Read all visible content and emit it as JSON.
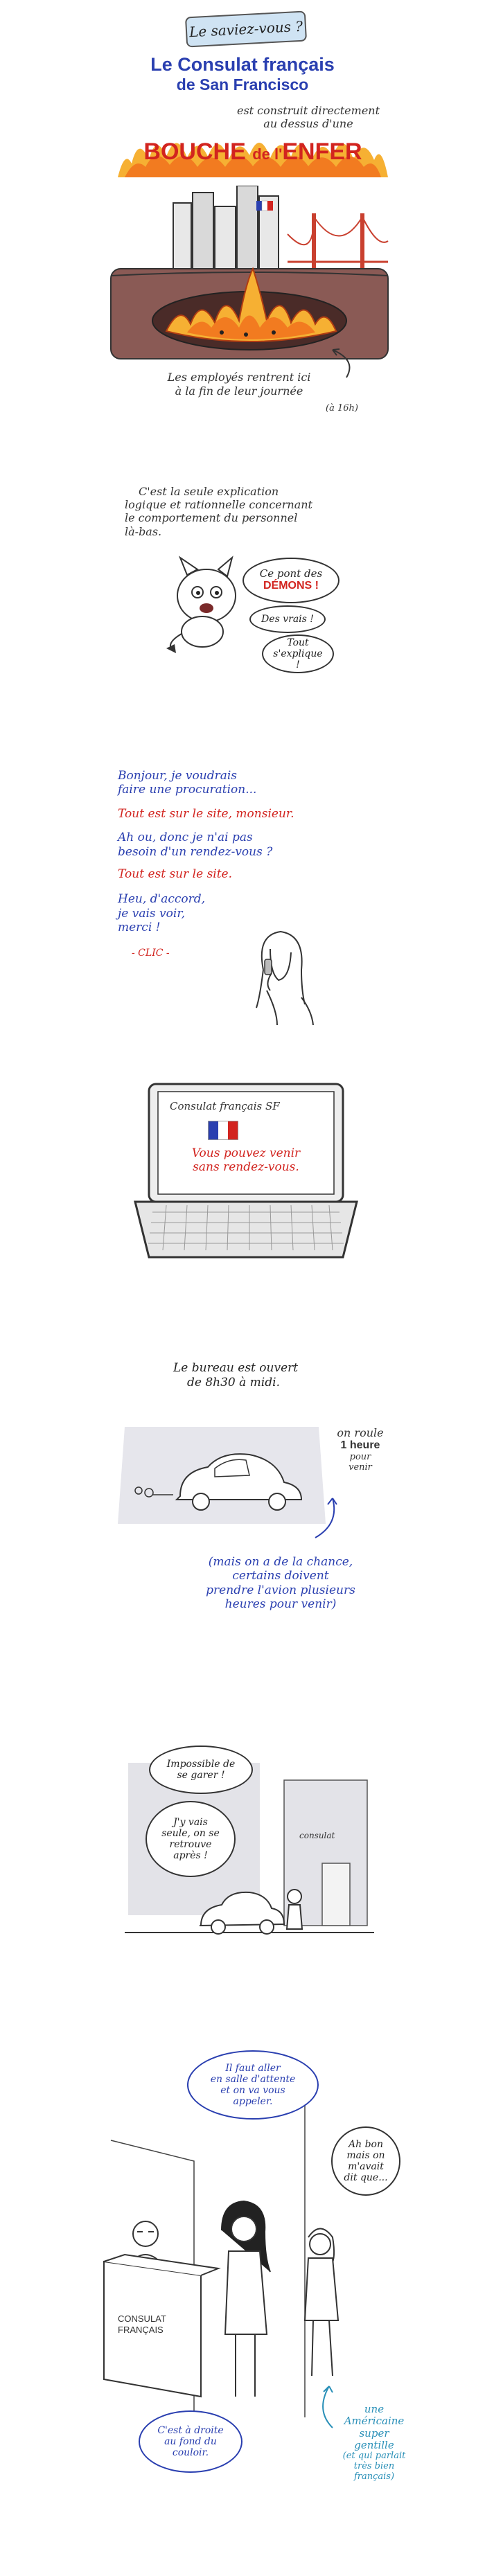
{
  "panel1": {
    "badge": "Le saviez-vous ?",
    "title_line1": "Le Consulat français",
    "title_line2": "de San Francisco",
    "subtitle_line1": "est construit directement",
    "subtitle_line2": "au dessus d'une",
    "headline_a": "BOUCHE",
    "headline_b": "de l'",
    "headline_c": "ENFER",
    "caption_line1": "Les employés rentrent ici",
    "caption_line2": "à la fin de leur journée",
    "caption_note": "(à 16h)"
  },
  "panel2": {
    "text_line1": "C'est la seule explication",
    "text_line2": "logique et rationnelle concernant",
    "text_line3": "le comportement du personnel",
    "text_line4": "là-bas.",
    "bubble1_a": "Ce pont des",
    "bubble1_b": "DÉMONS !",
    "bubble2": "Des vrais !",
    "bubble3_a": "Tout",
    "bubble3_b": "s'explique !"
  },
  "panel3": {
    "line1": "Bonjour, je voudrais",
    "line2": "faire une procuration...",
    "line3": "Tout est sur le site, monsieur.",
    "line4": "Ah ou, donc je n'ai pas",
    "line5": "besoin d'un rendez-vous ?",
    "line6": "Tout est sur le site.",
    "line7": "Heu, d'accord,",
    "line8": "je vais voir,",
    "line9": "merci !",
    "sfx": "- CLIC -"
  },
  "panel4": {
    "screen_title": "Consulat français SF",
    "screen_line1": "Vous pouvez venir",
    "screen_line2": "sans rendez-vous."
  },
  "panel5": {
    "hours_line1": "Le bureau est ouvert",
    "hours_line2": "de 8h30 à midi.",
    "drive_line1": "on roule",
    "drive_line2": "1 heure",
    "drive_line3": "pour",
    "drive_line4": "venir",
    "note_line1": "(mais on a de la chance,",
    "note_line2": "certains doivent",
    "note_line3": "prendre l'avion plusieurs",
    "note_line4": "heures pour venir)"
  },
  "panel6": {
    "bubble1_a": "Impossible de",
    "bubble1_b": "se garer !",
    "bubble2_a": "J'y vais",
    "bubble2_b": "seule, on se",
    "bubble2_c": "retrouve",
    "bubble2_d": "après !",
    "sign": "consulat"
  },
  "panel7": {
    "bubble1_a": "Il faut aller",
    "bubble1_b": "en salle d'attente",
    "bubble1_c": "et on va vous",
    "bubble1_d": "appeler.",
    "bubble2_a": "Ah bon",
    "bubble2_b": "mais on",
    "bubble2_c": "m'avait",
    "bubble2_d": "dit que...",
    "counter_line1": "CONSULAT",
    "counter_line2": "FRANÇAIS",
    "bubble3_a": "C'est à droite",
    "bubble3_b": "au fond du",
    "bubble3_c": "couloir.",
    "note_line1": "une",
    "note_line2": "Américaine",
    "note_line3": "super",
    "note_line4": "gentille",
    "note_line5": "(et qui parlait",
    "note_line6": "très bien",
    "note_line7": "français)"
  }
}
